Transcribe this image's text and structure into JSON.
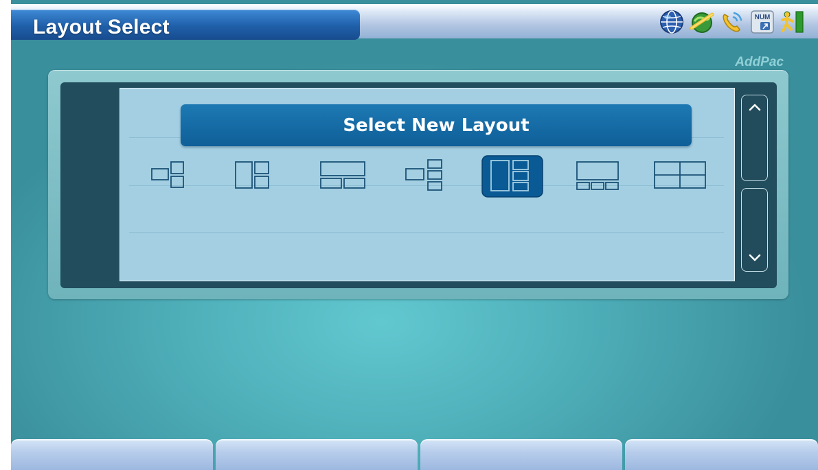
{
  "header": {
    "title": "Layout Select",
    "status_icons": [
      "globe-icon",
      "network-icon",
      "phone-call-icon",
      "numpad-icon",
      "exit-icon"
    ]
  },
  "brand": "AddPac",
  "layout_panel": {
    "heading": "Select New Layout",
    "selected_index": 4,
    "options": [
      {
        "name": "layout-1-small-plus-2-stacked"
      },
      {
        "name": "layout-1-large-plus-2-stacked"
      },
      {
        "name": "layout-wide-top-plus-2-bottom"
      },
      {
        "name": "layout-1-small-plus-3-stacked"
      },
      {
        "name": "layout-1-large-plus-3-stacked"
      },
      {
        "name": "layout-wide-top-plus-3-bottom"
      },
      {
        "name": "layout-2x2-grid"
      }
    ]
  },
  "scrollbar": {
    "up_icon": "chevron-up-icon",
    "down_icon": "chevron-down-icon"
  },
  "softkeys": [
    "",
    "",
    "",
    ""
  ],
  "colors": {
    "accent": "#0f5f98",
    "title_tab": "#1f5fa9",
    "selected_fill": "#0a5a95"
  }
}
